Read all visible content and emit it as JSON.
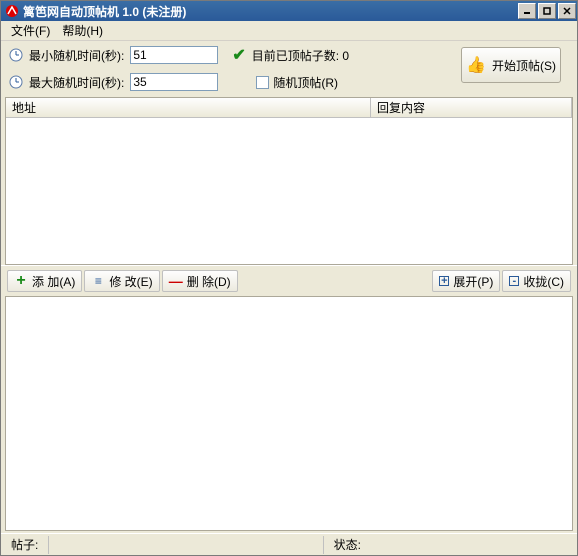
{
  "titlebar": {
    "title": "篱笆网自动顶帖机 1.0 (未注册)"
  },
  "menu": {
    "file": "文件(F)",
    "help": "帮助(H)"
  },
  "settings": {
    "min_label": "最小随机时间(秒):",
    "min_value": "51",
    "max_label": "最大随机时间(秒):",
    "max_value": "35",
    "posted_label": "目前已顶帖子数: 0",
    "random_cb_label": "随机顶帖(R)"
  },
  "start_button": "开始顶帖(S)",
  "table": {
    "col_addr": "地址",
    "col_reply": "回复内容"
  },
  "toolbar": {
    "add": "添 加(A)",
    "edit": "修 改(E)",
    "delete": "删 除(D)",
    "expand": "展开(P)",
    "collapse": "收拢(C)"
  },
  "status": {
    "post_label": "帖子:",
    "state_label": "状态:"
  }
}
